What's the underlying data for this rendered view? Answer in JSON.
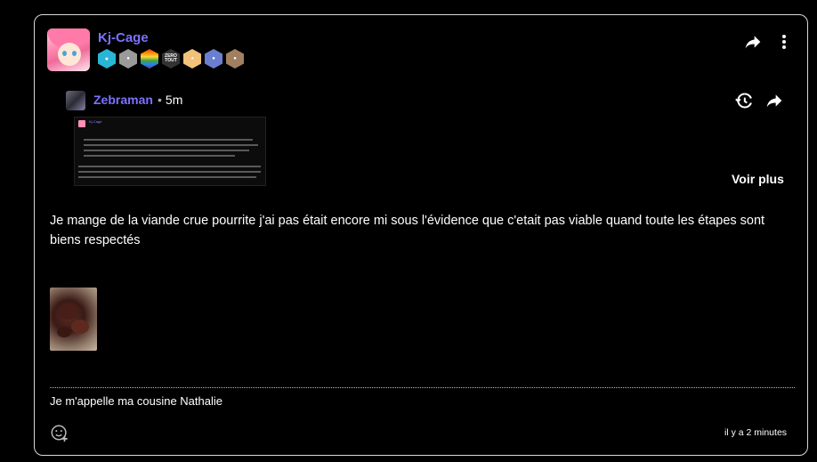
{
  "post": {
    "author": "Kj-Cage",
    "badges": [
      {
        "icon": "star-icon",
        "color": "#29b6d6"
      },
      {
        "icon": "person-badge-icon",
        "color": "#9a9a9a"
      },
      {
        "icon": "rainbow-flag-icon",
        "color": "#e05a9a"
      },
      {
        "icon": "zero-tout-icon",
        "color": "#333333",
        "text": "ZERO TOUT"
      },
      {
        "icon": "anime-girl-icon",
        "color": "#f0c27a"
      },
      {
        "icon": "man-glasses-icon",
        "color": "#6b7fd0"
      },
      {
        "icon": "bearded-man-icon",
        "color": "#a08060"
      }
    ],
    "reply": {
      "author": "Zebraman",
      "separator": "•",
      "time": "5m"
    },
    "voir_plus": "Voir plus",
    "message": "Je mange de la viande crue pourrite j'ai pas était encore mi sous l'évidence que c'etait pas viable quand toute les étapes sont biens respectés",
    "caption": "Je m'appelle ma cousine Nathalie",
    "timestamp": "il y a 2 minutes"
  },
  "thumbnail": {
    "mini_author": "Kj-Cage"
  },
  "colors": {
    "accent": "#7b72ff",
    "background": "#000000",
    "border": "#d9d9d9"
  }
}
